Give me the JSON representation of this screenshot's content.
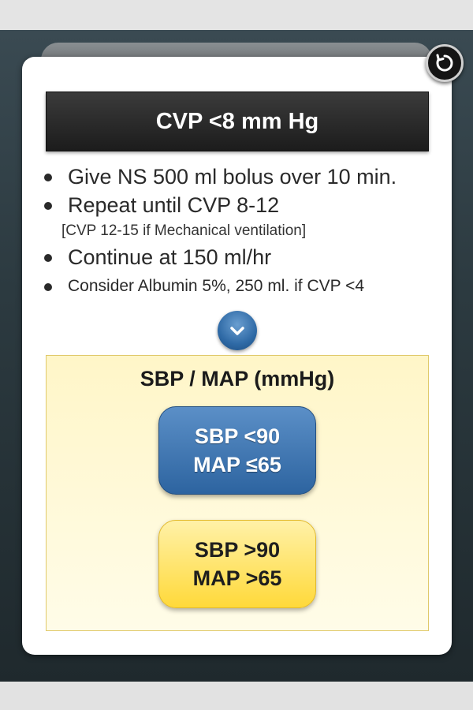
{
  "header": {
    "title": "CVP <8 mm Hg"
  },
  "instructions": {
    "item1": "Give NS 500 ml bolus over 10 min.",
    "item2": "Repeat until CVP 8-12",
    "item2_note": "[CVP 12-15 if Mechanical ventilation]",
    "item3": "Continue at 150 ml/hr",
    "item4": "Consider Albumin 5%, 250 ml. if CVP <4"
  },
  "decision": {
    "title": "SBP / MAP (mmHg)",
    "option_low": {
      "line1": "SBP <90",
      "line2": "MAP ≤65",
      "color": "#2d64a0"
    },
    "option_high": {
      "line1": "SBP >90",
      "line2": "MAP >65",
      "color": "#ffd93a"
    }
  },
  "icons": {
    "back": "back-arrow-icon",
    "expand": "chevron-down-icon"
  }
}
